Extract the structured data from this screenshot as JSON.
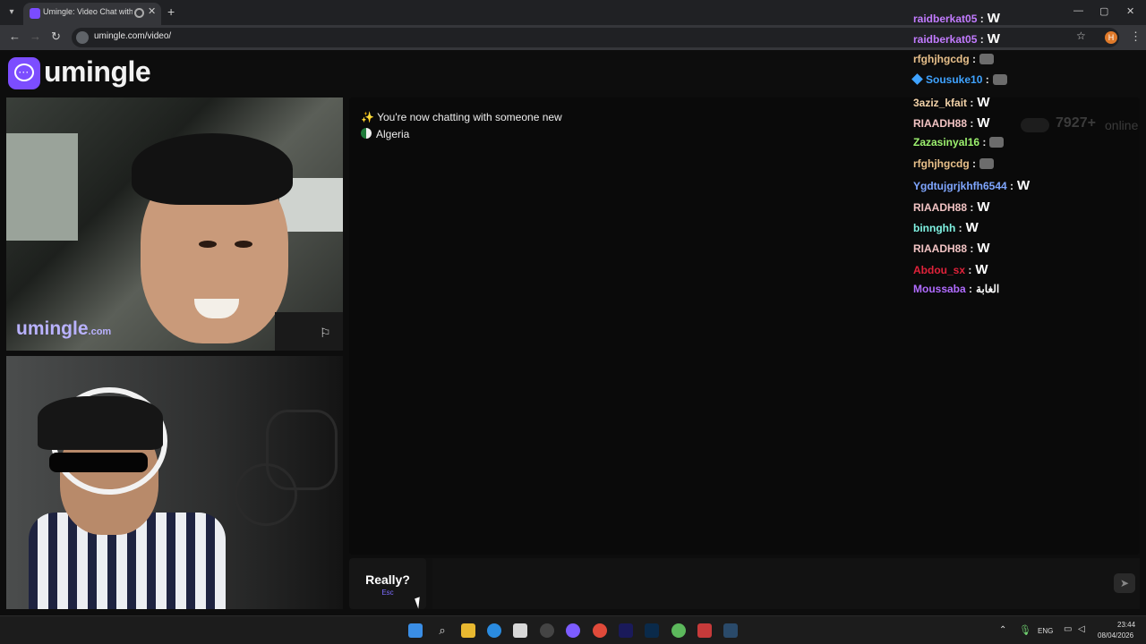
{
  "browser": {
    "tab_title": "Umingle: Video Chat with S",
    "tab_close": "✕",
    "new_tab": "+",
    "url": "umingle.com/video/",
    "window_controls": [
      "—",
      "▢",
      "✕"
    ],
    "nav": {
      "back": "←",
      "forward": "→",
      "reload": "↻"
    },
    "profile_initial": "H"
  },
  "site": {
    "logo_text": "umingle",
    "watermark_main": "umingle",
    "watermark_suffix": ".com"
  },
  "chat": {
    "system_message": "You're now chatting with someone new",
    "sparkle_icon": "✨",
    "country": "Algeria"
  },
  "livechat": {
    "messages": [
      {
        "user": "raidberkat05",
        "color": "#c27bff",
        "content": "W"
      },
      {
        "user": "raidberkat05",
        "color": "#c27bff",
        "content": "W"
      },
      {
        "user": "rfghjhgcdg",
        "color": "#e8c08a",
        "content": "emote"
      },
      {
        "user": "Sousuke10",
        "color": "#3fa3ff",
        "content": "emote",
        "badge": true
      },
      {
        "user": "3aziz_kfait",
        "color": "#f2d2a8",
        "content": "W"
      },
      {
        "user": "RIAADH88",
        "color": "#f1c3c3",
        "content": "W"
      },
      {
        "user": "Zazasinyal16",
        "color": "#9df26f",
        "content": "emote"
      },
      {
        "user": "rfghjhgcdg",
        "color": "#e8c08a",
        "content": "emote"
      },
      {
        "user": "Ygdtujgrjkhfh6544",
        "color": "#7fa6ff",
        "content": "W"
      },
      {
        "user": "RIAADH88",
        "color": "#f1c3c3",
        "content": "W"
      },
      {
        "user": "binnghh",
        "color": "#7ff2e2",
        "content": "W"
      },
      {
        "user": "RIAADH88",
        "color": "#f1c3c3",
        "content": "W"
      },
      {
        "user": "Abdou_sx",
        "color": "#e0223a",
        "content": "W"
      },
      {
        "user": "Moussaba",
        "color": "#b06bff",
        "content": "الغابة"
      }
    ],
    "separator": ":"
  },
  "online": {
    "count": "7927+",
    "label": "online"
  },
  "controls": {
    "skip_label": "Really?",
    "skip_hint": "Esc",
    "message_placeholder": "",
    "send_icon": "➤"
  },
  "taskbar": {
    "language": "ENG",
    "time": "23:44",
    "date": "08/04/2026"
  },
  "colors": {
    "brand": "#7c4dff",
    "background": "#0d0d0d"
  }
}
